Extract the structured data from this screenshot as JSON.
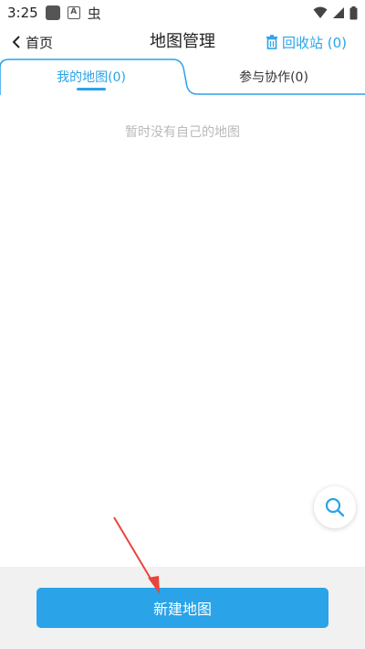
{
  "status_bar": {
    "time": "3:25",
    "left_icons": [
      "square-icon",
      "a-icon",
      "bug-icon"
    ],
    "bug_glyph": "虫",
    "a_glyph": "A",
    "right_icons": [
      "wifi-icon",
      "signal-icon",
      "battery-icon"
    ]
  },
  "header": {
    "back_label": "首页",
    "title": "地图管理",
    "recycle_label": "回收站 (0)"
  },
  "tabs": [
    {
      "label": "我的地图(0)",
      "active": true
    },
    {
      "label": "参与协作(0)",
      "active": false
    }
  ],
  "content": {
    "empty_text": "暂时没有自己的地图"
  },
  "bottom": {
    "create_button_label": "新建地图"
  },
  "colors": {
    "accent": "#2aa3e8",
    "empty_text": "#b9b9b9",
    "bottom_bg": "#f1f1f1",
    "annotation_arrow": "#e8453c"
  }
}
